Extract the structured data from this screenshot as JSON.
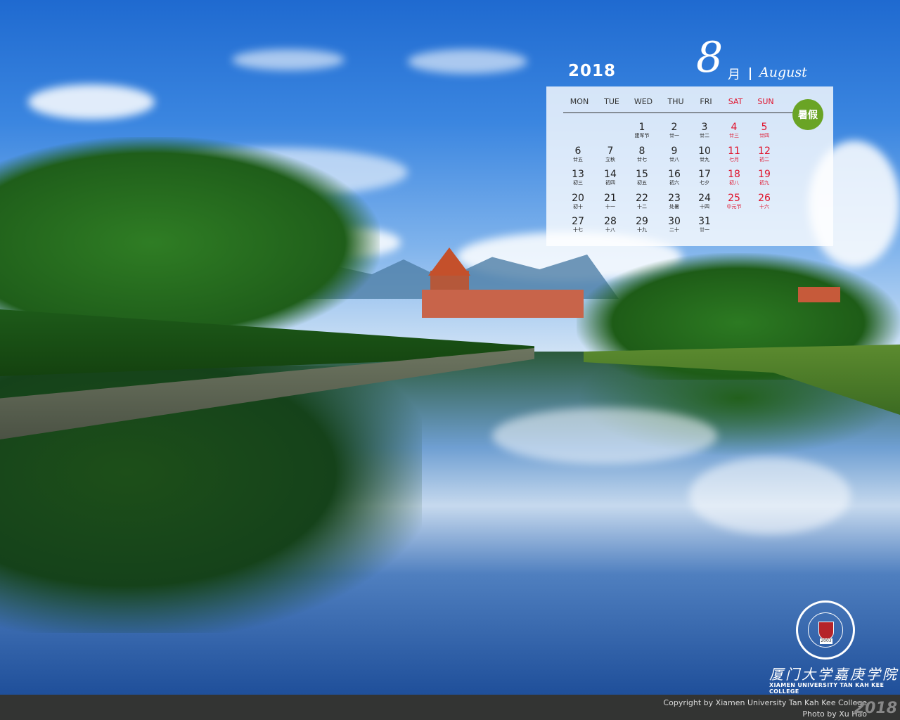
{
  "calendar": {
    "year": "2018",
    "month_number": "8",
    "month_cn": "月",
    "month_en": "August",
    "badge": "暑假",
    "weekdays": [
      "MON",
      "TUE",
      "WED",
      "THU",
      "FRI",
      "SAT",
      "SUN"
    ],
    "weeks": [
      [
        null,
        null,
        {
          "d": "1",
          "l": "建军节"
        },
        {
          "d": "2",
          "l": "廿一"
        },
        {
          "d": "3",
          "l": "廿二"
        },
        {
          "d": "4",
          "l": "廿三"
        },
        {
          "d": "5",
          "l": "廿四"
        }
      ],
      [
        {
          "d": "6",
          "l": "廿五"
        },
        {
          "d": "7",
          "l": "立秋"
        },
        {
          "d": "8",
          "l": "廿七"
        },
        {
          "d": "9",
          "l": "廿八"
        },
        {
          "d": "10",
          "l": "廿九"
        },
        {
          "d": "11",
          "l": "七月"
        },
        {
          "d": "12",
          "l": "初二"
        }
      ],
      [
        {
          "d": "13",
          "l": "初三"
        },
        {
          "d": "14",
          "l": "初四"
        },
        {
          "d": "15",
          "l": "初五"
        },
        {
          "d": "16",
          "l": "初六"
        },
        {
          "d": "17",
          "l": "七夕"
        },
        {
          "d": "18",
          "l": "初八"
        },
        {
          "d": "19",
          "l": "初九"
        }
      ],
      [
        {
          "d": "20",
          "l": "初十"
        },
        {
          "d": "21",
          "l": "十一"
        },
        {
          "d": "22",
          "l": "十二"
        },
        {
          "d": "23",
          "l": "处暑"
        },
        {
          "d": "24",
          "l": "十四"
        },
        {
          "d": "25",
          "l": "中元节"
        },
        {
          "d": "26",
          "l": "十六"
        }
      ],
      [
        {
          "d": "27",
          "l": "十七"
        },
        {
          "d": "28",
          "l": "十八"
        },
        {
          "d": "29",
          "l": "十九"
        },
        {
          "d": "30",
          "l": "二十"
        },
        {
          "d": "31",
          "l": "廿一"
        },
        null,
        null
      ]
    ]
  },
  "brand": {
    "name_cn": "厦门大学嘉庚学院",
    "name_en": "XIAMEN UNIVERSITY TAN KAH KEE COLLEGE",
    "logo_year": "2003"
  },
  "footer": {
    "copyright": "Copyright by Xiamen University Tan Kah Kee College",
    "photo": "Photo by Xu Hao",
    "year": "2018"
  },
  "colors": {
    "weekend": "#e0132c",
    "badge": "#6aa425"
  }
}
